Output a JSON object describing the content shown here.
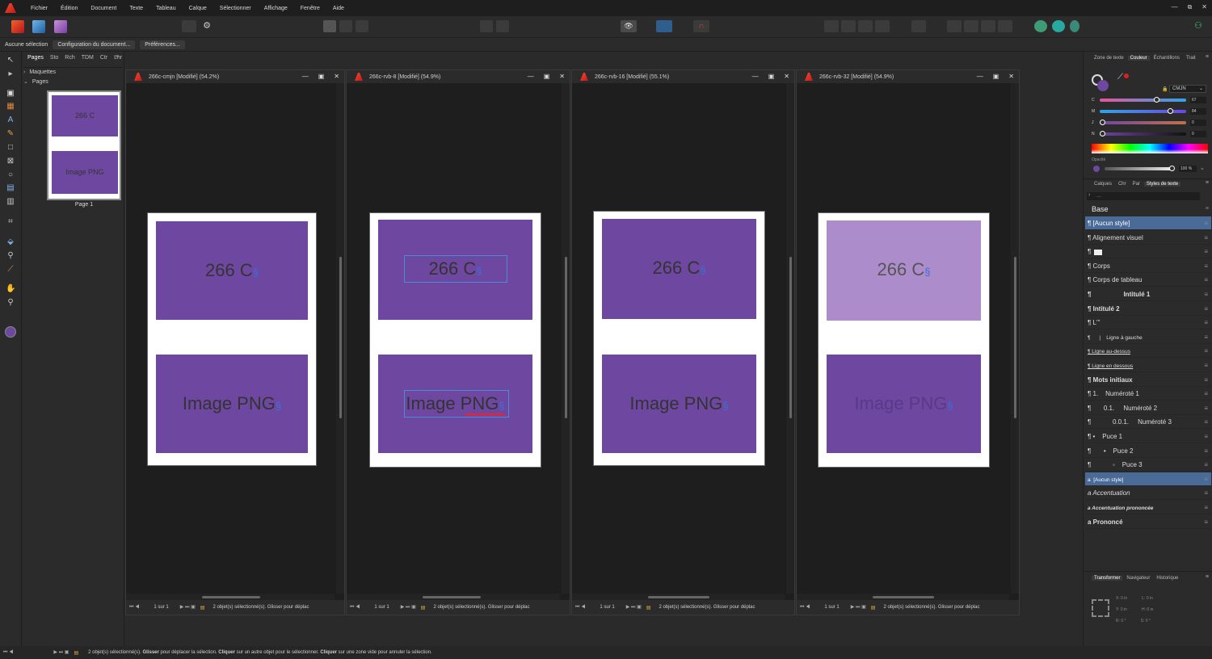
{
  "menu": [
    "Fichier",
    "Édition",
    "Document",
    "Texte",
    "Tableau",
    "Calque",
    "Sélectionner",
    "Affichage",
    "Fenêtre",
    "Aide"
  ],
  "window_controls": [
    "—",
    "⧉",
    "✕"
  ],
  "context": {
    "selection": "Aucune sélection",
    "doc_setup": "Configuration du document...",
    "preferences": "Préférences..."
  },
  "pages_panel": {
    "tabs": [
      "Pages",
      "Sto",
      "Rch",
      "TDM",
      "Ctr",
      "Lnr"
    ],
    "masters": "Maquettes",
    "pages": "Pages",
    "thumb_top": "266 C",
    "thumb_bottom": "Image PNG",
    "page_label": "Page 1"
  },
  "docs": [
    {
      "title": "266c-cmjn [Modifié] (54.2%)",
      "top_text": "266 C",
      "bottom_text": "Image PNG",
      "page_count": "1 sur 1",
      "status": "2 objet(s) sélectionné(s). Glisser pour déplac"
    },
    {
      "title": "266c-rvb-8 [Modifié] (54.9%)",
      "top_text": "266 C",
      "bottom_text": "Image PNG",
      "page_count": "1 sur 1",
      "status": "2 objet(s) sélectionné(s). Glisser pour déplac"
    },
    {
      "title": "266c-rvb-16 [Modifié] (55.1%)",
      "top_text": "266 C",
      "bottom_text": "Image PNG",
      "page_count": "1 sur 1",
      "status": "2 objet(s) sélectionné(s). Glisser pour déplac"
    },
    {
      "title": "266c-rvb-32 [Modifié] (54.9%)",
      "top_text": "266 C",
      "bottom_text": "Image PNG",
      "page_count": "1 sur 1",
      "status": "2 objet(s) sélectionné(s). Glisser pour déplac"
    }
  ],
  "color_panel": {
    "tabs": [
      "Zone de texte",
      "Couleur",
      "Échantillons",
      "Trait"
    ],
    "mode": "CMJN",
    "channels": [
      {
        "label": "C",
        "value": "67",
        "level": 0.67
      },
      {
        "label": "M",
        "value": "84",
        "level": 0.84
      },
      {
        "label": "J",
        "value": "0",
        "level": 0
      },
      {
        "label": "N",
        "value": "0",
        "level": 0
      }
    ],
    "opacity_label": "Opacité",
    "opacity_value": "100 %",
    "fill_color": "#6e47a0"
  },
  "styles_panel": {
    "tabs": [
      "Calques",
      "Chr",
      "Par",
      "Styles de texte"
    ],
    "search_placeholder": "...",
    "base": "Base",
    "rows": [
      "¶ [Aucun style]",
      "¶ Alignement visuel",
      "¶",
      "¶ Corps",
      "¶ Corps de tableau",
      "¶                  Intitulé 1",
      "¶ Intitulé 2",
      "¶ L'''",
      "¶      |    Ligne à gauche",
      "¶ Ligne au-dessus",
      "¶ Ligne en dessous",
      "¶ Mots initiaux",
      "¶ 1.    Numéroté 1",
      "¶       0.1.     Numéroté 2",
      "¶            0.0.1.     Numéroté 3",
      "¶ •    Puce 1",
      "¶       •    Puce 2",
      "¶            ◦    Puce 3",
      "a  [Aucun style]",
      "a Accentuation",
      "a Accentuation prononcée",
      "a Prononcé"
    ]
  },
  "transform_panel": {
    "tabs": [
      "Transformer",
      "Navigateur",
      "Historique"
    ],
    "x": "0 in",
    "y": "0 in",
    "w": "0 in",
    "h": "0 in",
    "r": "0 °",
    "s": "0 °"
  },
  "statusbar": {
    "p1": "2 objet(s) sélectionné(s). ",
    "b1": "Glisser",
    "p2": " pour déplacer la sélection. ",
    "b2": "Cliquer",
    "p3": " sur un autre objet pour le sélectionner. ",
    "b3": "Cliquer",
    "p4": " sur une zone vide pour annuler la sélection."
  }
}
